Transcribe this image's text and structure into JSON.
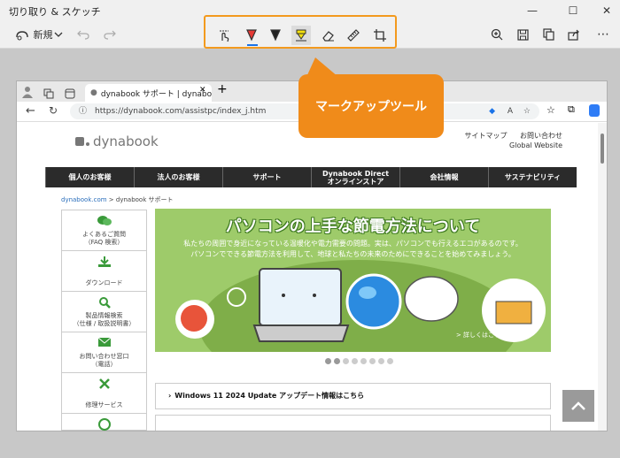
{
  "window": {
    "title": "切り取り & スケッチ",
    "minimize": "—",
    "maximize": "☐",
    "close": "✕"
  },
  "toolbar": {
    "new_label": "新規",
    "more": "⋯"
  },
  "callout": "マークアップツール",
  "browser": {
    "tab_title": "dynabook サポート | dynabook (ダ",
    "url": "https://dynabook.com/assistpc/index_j.htm"
  },
  "site": {
    "logo": "dynabook",
    "sitemap": "サイトマップ",
    "contact": "お問い合わせ",
    "global": "Global Website",
    "nav": [
      "個人のお客様",
      "法人のお客様",
      "サポート",
      "Dynabook Direct\nオンラインストア",
      "会社情報",
      "サステナビリティ"
    ],
    "breadcrumb_home": "dynabook.com",
    "breadcrumb_current": "> dynabook サポート",
    "sidebar": [
      {
        "label": "よくあるご質問\n（FAQ 検索）",
        "icon": "chat-bubbles-icon"
      },
      {
        "label": "ダウンロード",
        "icon": "download-icon"
      },
      {
        "label": "製品情報検索\n（仕様 / 取扱説明書）",
        "icon": "magnifier-icon"
      },
      {
        "label": "お問い合わせ窓口\n（電話）",
        "icon": "mail-icon"
      },
      {
        "label": "修理サービス",
        "icon": "tools-icon"
      }
    ],
    "banner_title": "パソコンの上手な節電方法について",
    "banner_sub": "私たちの周囲で身近になっている温暖化や電力需要の問題。実は、パソコンでも行えるエコがあるのです。\nパソコンでできる節電方法を利用して、地球と私たちの未来のためにできることを始めてみましょう。",
    "banner_more": "> 詳しくはこちら",
    "news_item": "Windows 11 2024 Update アップデート情報はこちら"
  },
  "colors": {
    "accent": "#f08b1a",
    "highlight_border": "#f39a1e",
    "nav_bg": "#2b2b2b",
    "banner_green": "#9ecb6a"
  }
}
